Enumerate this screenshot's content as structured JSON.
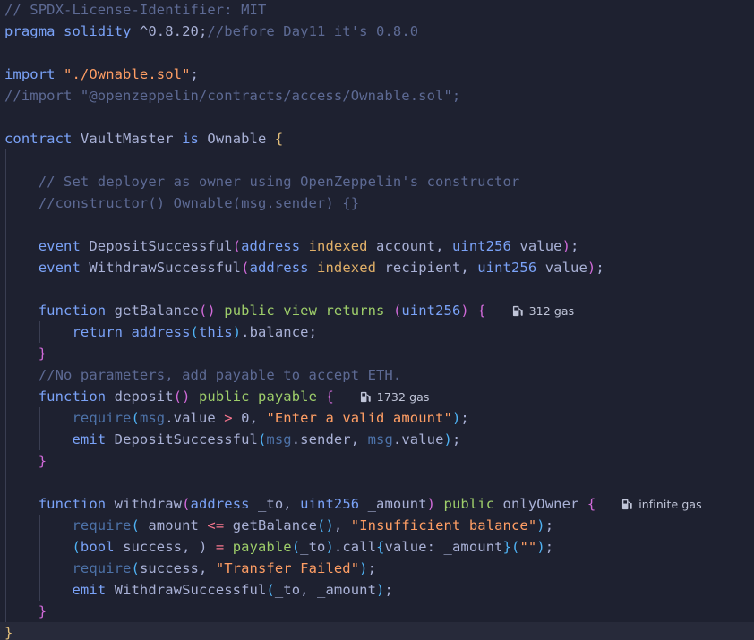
{
  "colors": {
    "background": "#1e2130",
    "current_line": "#272a3a",
    "comment": "#5d6a94",
    "keyword": "#7aa2f7",
    "string": "#ff9e64",
    "bracket_gold": "#e5c07b",
    "bracket_magenta": "#d16ad9",
    "bracket_blue": "#4fb3f5",
    "text": "#a9b1d6",
    "green": "#9ece6a",
    "purple": "#bb9af7",
    "orange": "#e0af68",
    "red": "#f7768e",
    "msg": "#4d72a8",
    "gas_lens": "#c0c5d8"
  },
  "gas_icon": "fuel-pump-icon",
  "lines": [
    [
      [
        "// SPDX-License-Identifier: MIT",
        "comment"
      ]
    ],
    [
      [
        "pragma",
        "keyword"
      ],
      [
        " ",
        "text"
      ],
      [
        "solidity",
        "keyword"
      ],
      [
        " ^0.8.20;",
        "text"
      ],
      [
        "//before Day11 it's 0.8.0",
        "comment"
      ]
    ],
    [],
    [
      [
        "import",
        "keyword"
      ],
      [
        " ",
        "text"
      ],
      [
        "\"./Ownable.sol\"",
        "string"
      ],
      [
        ";",
        "text"
      ]
    ],
    [
      [
        "//import \"@openzeppelin/contracts/access/Ownable.sol\";",
        "comment"
      ]
    ],
    [],
    [
      [
        "contract",
        "keyword"
      ],
      [
        " VaultMaster ",
        "text"
      ],
      [
        "is",
        "keyword"
      ],
      [
        " Ownable ",
        "text"
      ],
      [
        "{",
        "bracket_gold"
      ]
    ],
    [],
    [
      [
        "    ",
        "text"
      ],
      [
        "// Set deployer as owner using OpenZeppelin's constructor",
        "comment"
      ]
    ],
    [
      [
        "    ",
        "text"
      ],
      [
        "//constructor() Ownable(msg.sender) {}",
        "comment"
      ]
    ],
    [],
    [
      [
        "    ",
        "text"
      ],
      [
        "event",
        "keyword"
      ],
      [
        " DepositSuccessful",
        "text"
      ],
      [
        "(",
        "bracket_magenta"
      ],
      [
        "address",
        "keyword"
      ],
      [
        " ",
        "text"
      ],
      [
        "indexed",
        "orange"
      ],
      [
        " account, ",
        "text"
      ],
      [
        "uint256",
        "keyword"
      ],
      [
        " value",
        "text"
      ],
      [
        ")",
        "bracket_magenta"
      ],
      [
        ";",
        "text"
      ]
    ],
    [
      [
        "    ",
        "text"
      ],
      [
        "event",
        "keyword"
      ],
      [
        " WithdrawSuccessful",
        "text"
      ],
      [
        "(",
        "bracket_magenta"
      ],
      [
        "address",
        "keyword"
      ],
      [
        " ",
        "text"
      ],
      [
        "indexed",
        "orange"
      ],
      [
        " recipient, ",
        "text"
      ],
      [
        "uint256",
        "keyword"
      ],
      [
        " value",
        "text"
      ],
      [
        ")",
        "bracket_magenta"
      ],
      [
        ";",
        "text"
      ]
    ],
    [],
    [
      [
        "    ",
        "text"
      ],
      [
        "function",
        "keyword"
      ],
      [
        " getBalance",
        "text"
      ],
      [
        "()",
        "bracket_magenta"
      ],
      [
        " ",
        "text"
      ],
      [
        "public",
        "green"
      ],
      [
        " ",
        "text"
      ],
      [
        "view",
        "green"
      ],
      [
        " ",
        "text"
      ],
      [
        "returns",
        "green"
      ],
      [
        " ",
        "text"
      ],
      [
        "(",
        "bracket_magenta"
      ],
      [
        "uint256",
        "keyword"
      ],
      [
        ")",
        "bracket_magenta"
      ],
      [
        " ",
        "text"
      ],
      [
        "{",
        "bracket_magenta"
      ],
      [
        "  ",
        "text"
      ],
      [
        "312 gas",
        "gas"
      ]
    ],
    [
      [
        "        ",
        "text"
      ],
      [
        "return",
        "keyword"
      ],
      [
        " ",
        "text"
      ],
      [
        "address",
        "keyword"
      ],
      [
        "(",
        "bracket_blue"
      ],
      [
        "this",
        "keyword"
      ],
      [
        ")",
        "bracket_blue"
      ],
      [
        ".balance;",
        "text"
      ]
    ],
    [
      [
        "    ",
        "text"
      ],
      [
        "}",
        "bracket_magenta"
      ]
    ],
    [
      [
        "    ",
        "text"
      ],
      [
        "//No parameters, add payable to accept ETH.",
        "comment"
      ]
    ],
    [
      [
        "    ",
        "text"
      ],
      [
        "function",
        "keyword"
      ],
      [
        " deposit",
        "text"
      ],
      [
        "()",
        "bracket_magenta"
      ],
      [
        " ",
        "text"
      ],
      [
        "public",
        "green"
      ],
      [
        " ",
        "text"
      ],
      [
        "payable",
        "green"
      ],
      [
        " ",
        "text"
      ],
      [
        "{",
        "bracket_magenta"
      ],
      [
        "  ",
        "text"
      ],
      [
        "1732 gas",
        "gas"
      ]
    ],
    [
      [
        "        ",
        "text"
      ],
      [
        "require",
        "msg"
      ],
      [
        "(",
        "bracket_blue"
      ],
      [
        "msg",
        "msg"
      ],
      [
        ".value ",
        "text"
      ],
      [
        ">",
        "red"
      ],
      [
        " 0, ",
        "text"
      ],
      [
        "\"Enter a valid amount\"",
        "string"
      ],
      [
        ")",
        "bracket_blue"
      ],
      [
        ";",
        "text"
      ]
    ],
    [
      [
        "        ",
        "text"
      ],
      [
        "emit",
        "keyword"
      ],
      [
        " DepositSuccessful",
        "text"
      ],
      [
        "(",
        "bracket_blue"
      ],
      [
        "msg",
        "msg"
      ],
      [
        ".sender, ",
        "text"
      ],
      [
        "msg",
        "msg"
      ],
      [
        ".value",
        "text"
      ],
      [
        ")",
        "bracket_blue"
      ],
      [
        ";",
        "text"
      ]
    ],
    [
      [
        "    ",
        "text"
      ],
      [
        "}",
        "bracket_magenta"
      ]
    ],
    [],
    [
      [
        "    ",
        "text"
      ],
      [
        "function",
        "keyword"
      ],
      [
        " withdraw",
        "text"
      ],
      [
        "(",
        "bracket_magenta"
      ],
      [
        "address",
        "keyword"
      ],
      [
        " _to, ",
        "text"
      ],
      [
        "uint256",
        "keyword"
      ],
      [
        " _amount",
        "text"
      ],
      [
        ")",
        "bracket_magenta"
      ],
      [
        " ",
        "text"
      ],
      [
        "public",
        "green"
      ],
      [
        " onlyOwner ",
        "text"
      ],
      [
        "{",
        "bracket_magenta"
      ],
      [
        "  ",
        "text"
      ],
      [
        "infinite gas",
        "gas"
      ]
    ],
    [
      [
        "        ",
        "text"
      ],
      [
        "require",
        "msg"
      ],
      [
        "(",
        "bracket_blue"
      ],
      [
        "_amount ",
        "text"
      ],
      [
        "<=",
        "red"
      ],
      [
        " getBalance",
        "text"
      ],
      [
        "()",
        "bracket_blue"
      ],
      [
        ", ",
        "text"
      ],
      [
        "\"Insufficient balance\"",
        "string"
      ],
      [
        ")",
        "bracket_blue"
      ],
      [
        ";",
        "text"
      ]
    ],
    [
      [
        "        ",
        "text"
      ],
      [
        "(",
        "bracket_blue"
      ],
      [
        "bool",
        "keyword"
      ],
      [
        " success, ) ",
        "text"
      ],
      [
        "=",
        "red"
      ],
      [
        " ",
        "text"
      ],
      [
        "payable",
        "green"
      ],
      [
        "(",
        "bracket_blue"
      ],
      [
        "_to",
        "text"
      ],
      [
        ")",
        "bracket_blue"
      ],
      [
        ".call",
        "text"
      ],
      [
        "{",
        "bracket_blue"
      ],
      [
        "value: _amount",
        "text"
      ],
      [
        "}",
        "bracket_blue"
      ],
      [
        "(",
        "bracket_blue"
      ],
      [
        "\"\"",
        "string"
      ],
      [
        ")",
        "bracket_blue"
      ],
      [
        ";",
        "text"
      ]
    ],
    [
      [
        "        ",
        "text"
      ],
      [
        "require",
        "msg"
      ],
      [
        "(",
        "bracket_blue"
      ],
      [
        "success, ",
        "text"
      ],
      [
        "\"Transfer Failed\"",
        "string"
      ],
      [
        ")",
        "bracket_blue"
      ],
      [
        ";",
        "text"
      ]
    ],
    [
      [
        "        ",
        "text"
      ],
      [
        "emit",
        "keyword"
      ],
      [
        " WithdrawSuccessful",
        "text"
      ],
      [
        "(",
        "bracket_blue"
      ],
      [
        "_to, _amount",
        "text"
      ],
      [
        ")",
        "bracket_blue"
      ],
      [
        ";",
        "text"
      ]
    ],
    [
      [
        "    ",
        "text"
      ],
      [
        "}",
        "bracket_magenta"
      ]
    ],
    [
      [
        "}",
        "bracket_gold"
      ]
    ]
  ]
}
